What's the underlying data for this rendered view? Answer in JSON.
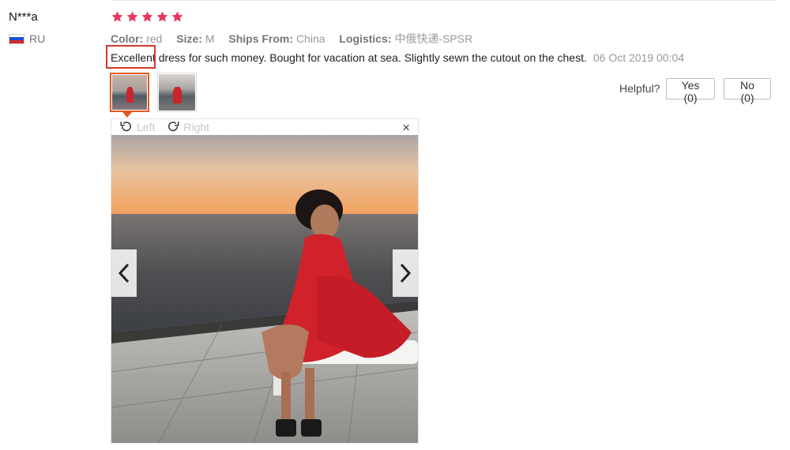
{
  "reviewer": {
    "name": "N***a",
    "country_code": "RU",
    "flag_colors": [
      "#ffffff",
      "#1c4ed8",
      "#d62828"
    ]
  },
  "rating": {
    "stars": 5,
    "max": 5,
    "color": "#e8365d"
  },
  "attributes": [
    {
      "key": "Color:",
      "value": "red"
    },
    {
      "key": "Size:",
      "value": "M"
    },
    {
      "key": "Ships From:",
      "value": "China"
    },
    {
      "key": "Logistics:",
      "value": "中俄快递-SPSR"
    }
  ],
  "review": {
    "first_word": "Excellent",
    "rest": " dress for such money. Bought for vacation at sea. Slightly sewn the cutout on the chest.",
    "date": "06 Oct 2019 00:04"
  },
  "thumbnails": [
    {
      "label": "photo-1",
      "active": true
    },
    {
      "label": "photo-2",
      "active": false
    }
  ],
  "viewer": {
    "rotate_left": "Left",
    "rotate_right": "Right",
    "close_symbol": "×",
    "prev_icon": "chevron-left-icon",
    "next_icon": "chevron-right-icon"
  },
  "feedback": {
    "label": "Helpful?",
    "yes": "Yes (0)",
    "no": "No (0)"
  },
  "colors": {
    "highlight": "#d33a2c",
    "active_thumb": "#e05a1f"
  }
}
